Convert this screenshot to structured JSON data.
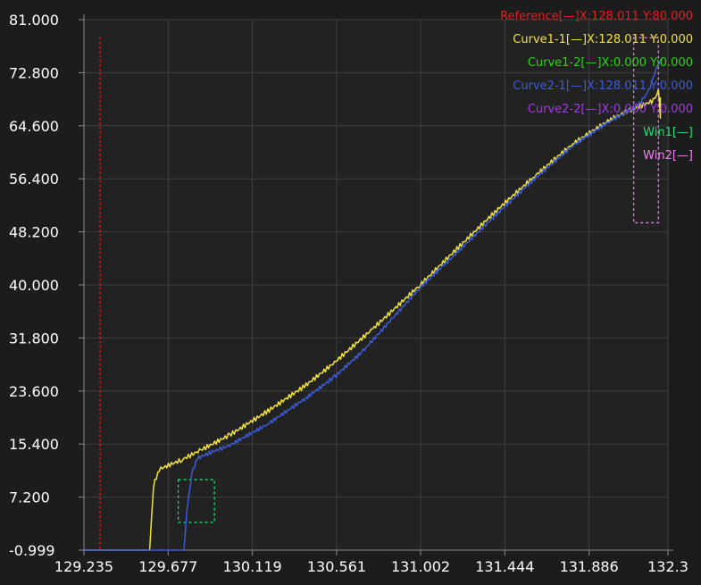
{
  "colors": {
    "background": "#222222",
    "grid": "#3f3f3f",
    "axis": "#8a8a8a",
    "tick_text": "#ffffff",
    "reference": "#e02020",
    "curve1_1": "#f1e33a",
    "curve1_2": "#2fd21f",
    "curve2_1": "#3d5bd8",
    "curve2_2": "#a23be0",
    "win1": "#22dd77",
    "win2": "#ee80ee"
  },
  "legend": [
    {
      "label": "Reference[—]X:128.011 Y:80.000",
      "color": "#e02020"
    },
    {
      "label": "Curve1-1[—]X:128.011 Y:0.000",
      "color": "#f1e33a"
    },
    {
      "label": "Curve1-2[—]X:0.000 Y:0.000",
      "color": "#2fd21f"
    },
    {
      "label": "Curve2-1[—]X:128.011 Y:0.000",
      "color": "#3d5bd8"
    },
    {
      "label": "Curve2-2[—]X:0.000 Y:0.000",
      "color": "#a23be0"
    },
    {
      "label": "Win1[—]",
      "color": "#22dd77"
    },
    {
      "label": "Win2[—]",
      "color": "#ee80ee"
    }
  ],
  "chart_data": {
    "type": "line",
    "xlim": [
      129.235,
      132.3
    ],
    "ylim": [
      -0.999,
      81.0
    ],
    "x_ticks": [
      129.235,
      129.677,
      130.119,
      130.561,
      131.002,
      131.444,
      131.886,
      132.3
    ],
    "x_tick_labels": [
      "129.235",
      "129.677",
      "130.119",
      "130.561",
      "131.002",
      "131.444",
      "131.886",
      "132.3"
    ],
    "y_ticks": [
      81.0,
      72.8,
      64.6,
      56.4,
      48.2,
      40.0,
      31.8,
      23.6,
      15.4,
      7.2,
      -0.999
    ],
    "y_tick_labels": [
      "81.000",
      "72.800",
      "64.600",
      "56.400",
      "48.200",
      "40.000",
      "31.800",
      "23.600",
      "15.400",
      "7.200",
      "-0.999"
    ],
    "grid": true,
    "legend_position": "top-right",
    "reference_line": {
      "x": 129.32
    },
    "series": [
      {
        "name": "Curve1-1",
        "color": "#f1e33a",
        "x": [
          129.235,
          129.58,
          129.6,
          129.63,
          129.75,
          129.85,
          130.0,
          130.2,
          130.4,
          130.55,
          130.75,
          131.0,
          131.2,
          131.4,
          131.6,
          131.8,
          132.0,
          132.1,
          132.17,
          132.23,
          132.25,
          132.26,
          132.26
        ],
        "y": [
          -1.0,
          -1.0,
          9.0,
          11.5,
          13.0,
          14.5,
          16.8,
          20.5,
          24.5,
          28.0,
          33.2,
          40.0,
          45.8,
          51.5,
          56.8,
          61.8,
          65.6,
          67.0,
          67.8,
          68.6,
          70.2,
          66.0,
          69.0
        ],
        "jitter": 0.35
      },
      {
        "name": "Curve2-1",
        "color": "#3d5bd8",
        "x": [
          129.235,
          129.76,
          129.775,
          129.8,
          129.83,
          129.9,
          130.0,
          130.2,
          130.4,
          130.55,
          130.7,
          130.85,
          131.0,
          131.2,
          131.4,
          131.6,
          131.8,
          132.0,
          132.1,
          132.15,
          132.2,
          132.24,
          132.27
        ],
        "y": [
          -1.0,
          -1.0,
          5.0,
          10.8,
          13.2,
          14.1,
          15.2,
          18.5,
          22.5,
          25.8,
          29.8,
          34.7,
          39.6,
          45.2,
          50.9,
          56.4,
          61.5,
          65.4,
          67.0,
          68.0,
          70.0,
          73.6,
          75.0
        ],
        "jitter": 0.3
      }
    ],
    "windows": [
      {
        "name": "Win1",
        "color": "#22dd77",
        "x": [
          129.73,
          129.92
        ],
        "y": [
          3.3,
          9.9
        ]
      },
      {
        "name": "Win2",
        "color": "#ee80ee",
        "x": [
          132.12,
          132.25
        ],
        "y": [
          49.6,
          78.2
        ]
      }
    ]
  }
}
